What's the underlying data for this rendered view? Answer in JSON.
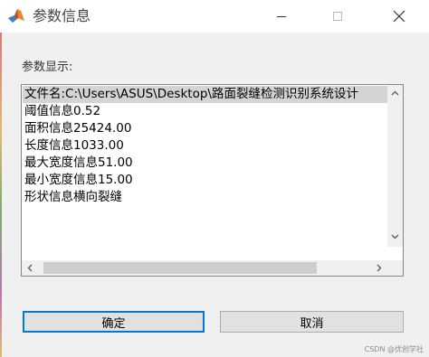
{
  "window": {
    "title": "参数信息",
    "app_icon": "matlab-logo-icon",
    "controls": [
      "minimize-icon",
      "maximize-icon",
      "close-icon"
    ]
  },
  "panel": {
    "label": "参数显示:"
  },
  "list": {
    "items": [
      "文件名:C:\\Users\\ASUS\\Desktop\\路面裂缝检测识别系统设计",
      "阈值信息0.52",
      "面积信息25424.00",
      "长度信息1033.00",
      "最大宽度信息51.00",
      "最小宽度信息15.00",
      "形状信息横向裂缝"
    ],
    "selected_index": 0
  },
  "buttons": {
    "ok": "确定",
    "cancel": "取消"
  },
  "watermark": "CSDN @优创学社",
  "colors": {
    "focus_border": "#0078d7",
    "selection": "#d4d4d4",
    "button_face": "#e1e1e1"
  }
}
